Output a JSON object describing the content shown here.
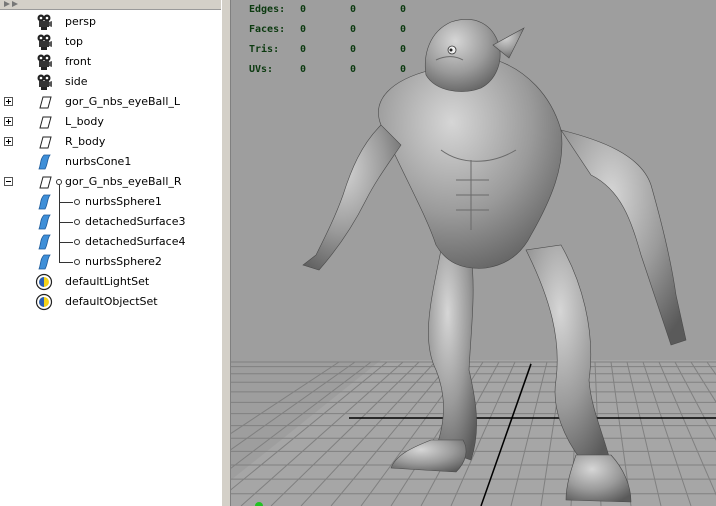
{
  "outliner": {
    "items": [
      {
        "label": "persp",
        "icon": "camera-icon"
      },
      {
        "label": "top",
        "icon": "camera-icon"
      },
      {
        "label": "front",
        "icon": "camera-icon"
      },
      {
        "label": "side",
        "icon": "camera-icon"
      },
      {
        "label": "gor_G_nbs_eyeBall_L",
        "icon": "transform-icon",
        "expander": "plus"
      },
      {
        "label": "L_body",
        "icon": "transform-icon",
        "expander": "plus"
      },
      {
        "label": "R_body",
        "icon": "transform-icon",
        "expander": "plus"
      },
      {
        "label": "nurbsCone1",
        "icon": "nurbs-surface-icon"
      },
      {
        "label": "gor_G_nbs_eyeBall_R",
        "icon": "transform-icon",
        "expander": "minus"
      },
      {
        "label": "nurbsSphere1",
        "icon": "nurbs-surface-icon"
      },
      {
        "label": "detachedSurface3",
        "icon": "nurbs-surface-icon"
      },
      {
        "label": "detachedSurface4",
        "icon": "nurbs-surface-icon"
      },
      {
        "label": "nurbsSphere2",
        "icon": "nurbs-surface-icon"
      },
      {
        "label": "defaultLightSet",
        "icon": "light-set-icon"
      },
      {
        "label": "defaultObjectSet",
        "icon": "object-set-icon"
      }
    ]
  },
  "viewport": {
    "hud": [
      {
        "label": "Edges:",
        "values": [
          "0",
          "0",
          "0"
        ]
      },
      {
        "label": "Faces:",
        "values": [
          "0",
          "0",
          "0"
        ]
      },
      {
        "label": "Tris:",
        "values": [
          "0",
          "0",
          "0"
        ]
      },
      {
        "label": "UVs:",
        "values": [
          "0",
          "0",
          "0"
        ]
      }
    ]
  },
  "colors": {
    "viewport_bg": "#9e9e9e",
    "grid": "#7d7d7d",
    "grid_axis": "#000000",
    "hud_text": "#0c3a10",
    "model": "#8d8d8d",
    "nurbs_icon": "#3f8fd8"
  }
}
